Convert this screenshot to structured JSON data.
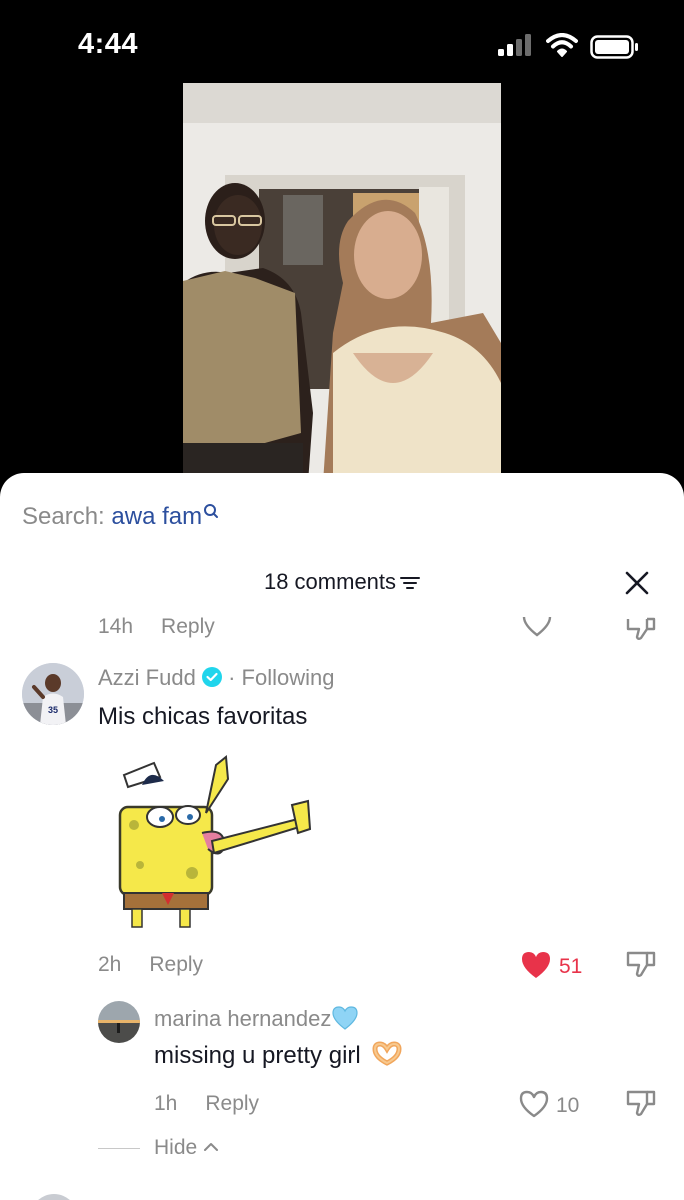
{
  "status_bar": {
    "time": "4:44"
  },
  "search": {
    "label": "Search: ",
    "query": "awa fam"
  },
  "comments_header": {
    "count_label": "18 comments"
  },
  "prev_comment": {
    "time": "14h",
    "reply": "Reply"
  },
  "comment": {
    "author": "Azzi Fudd",
    "following": "Following",
    "text": "Mis chicas favoritas",
    "time": "2h",
    "reply": "Reply",
    "likes": "51"
  },
  "reply": {
    "author": "marina hernandez",
    "text": "missing u pretty girl",
    "time": "1h",
    "reply": "Reply",
    "likes": "10"
  },
  "thread": {
    "hide_label": "Hide"
  },
  "colors": {
    "accent_red": "#e8334a",
    "search_blue": "#2c4f9e",
    "verified": "#20d5ec"
  }
}
